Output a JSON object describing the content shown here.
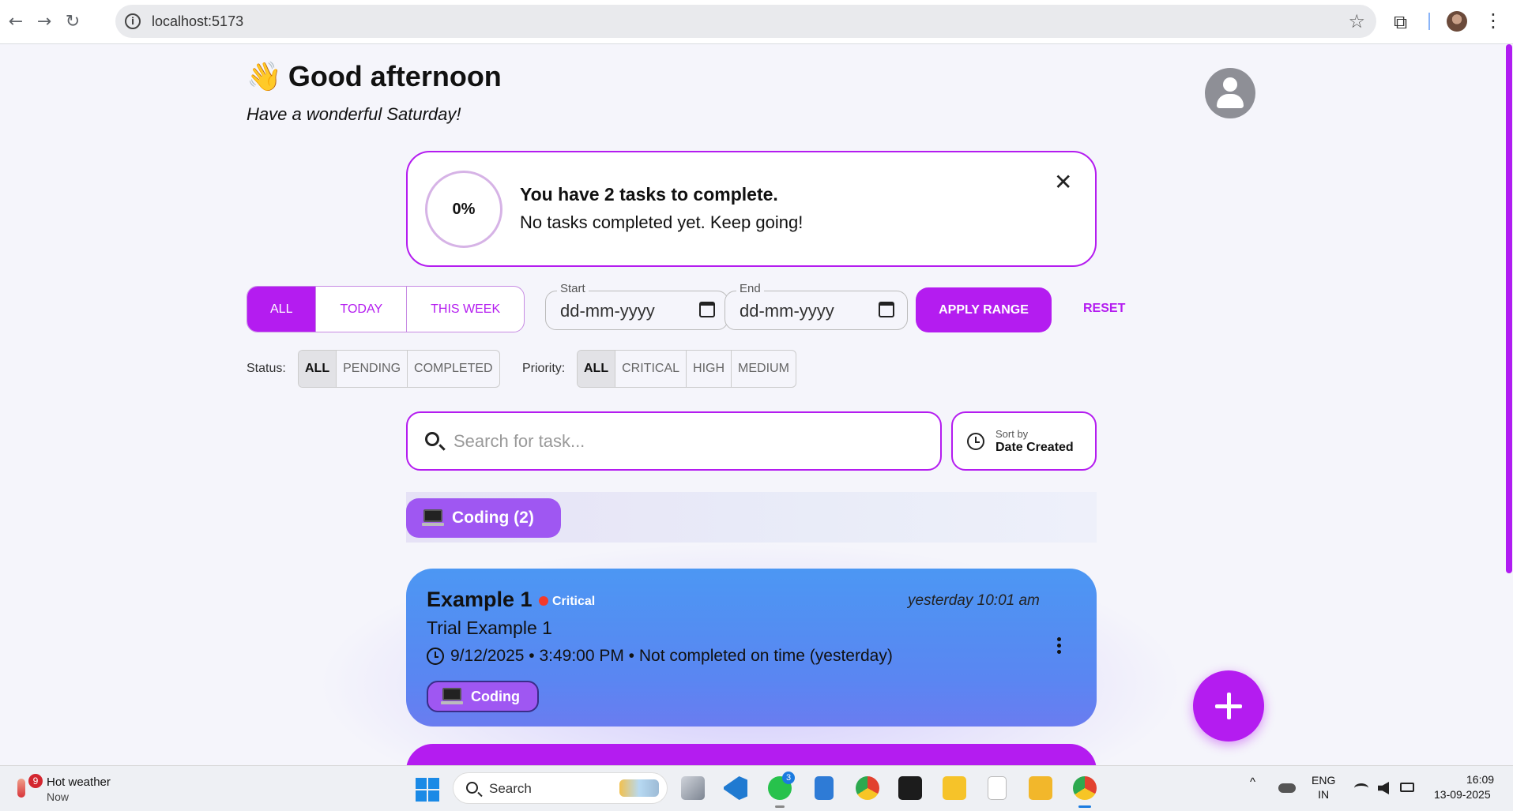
{
  "browser": {
    "back_icon": "←",
    "forward_icon": "→",
    "reload_icon": "↻",
    "url": "localhost:5173",
    "info_icon": "i",
    "star_icon": "☆",
    "extensions_icon": "⧉",
    "menu_icon": "⋮"
  },
  "header": {
    "wave_emoji": "👋",
    "greeting": "Good afternoon",
    "subtitle": "Have a wonderful Saturday!"
  },
  "progress": {
    "percent_text": "0%",
    "percent_value": 0,
    "title": "You have 2 tasks to complete.",
    "message": "No tasks completed yet. Keep going!",
    "close_icon": "✕"
  },
  "range_filter": {
    "tabs": [
      "ALL",
      "TODAY",
      "THIS WEEK"
    ],
    "active_tab": "ALL",
    "start": {
      "label": "Start",
      "value": "dd-mm-yyyy"
    },
    "end": {
      "label": "End",
      "value": "dd-mm-yyyy"
    },
    "apply_label": "APPLY RANGE",
    "reset_label": "RESET"
  },
  "status_filter": {
    "label": "Status:",
    "options": [
      "ALL",
      "PENDING",
      "COMPLETED"
    ],
    "active": "ALL"
  },
  "priority_filter": {
    "label": "Priority:",
    "options": [
      "ALL",
      "CRITICAL",
      "HIGH",
      "MEDIUM"
    ],
    "active": "ALL"
  },
  "search": {
    "placeholder": "Search for task..."
  },
  "sort": {
    "small_label": "Sort by",
    "value": "Date Created"
  },
  "category": {
    "label": "Coding (2)",
    "icon": "laptop-icon"
  },
  "tasks": [
    {
      "title": "Example 1",
      "priority": "Critical",
      "created": "yesterday 10:01 am",
      "description": "Trial Example 1",
      "due": "9/12/2025 • 3:49:00 PM • Not completed on time (yesterday)",
      "tag": "Coding"
    }
  ],
  "taskbar": {
    "weather_badge": "9",
    "weather_title": "Hot weather",
    "weather_sub": "Now",
    "search_label": "Search",
    "whatsapp_badge": "3",
    "lang_line1": "ENG",
    "lang_line2": "IN",
    "time": "16:09",
    "date": "13-09-2025",
    "chevron_icon": "^"
  },
  "colors": {
    "accent": "#b41cf0",
    "category": "#9f57f2",
    "task_card": "#4c97f3",
    "critical": "#f33a2a"
  }
}
